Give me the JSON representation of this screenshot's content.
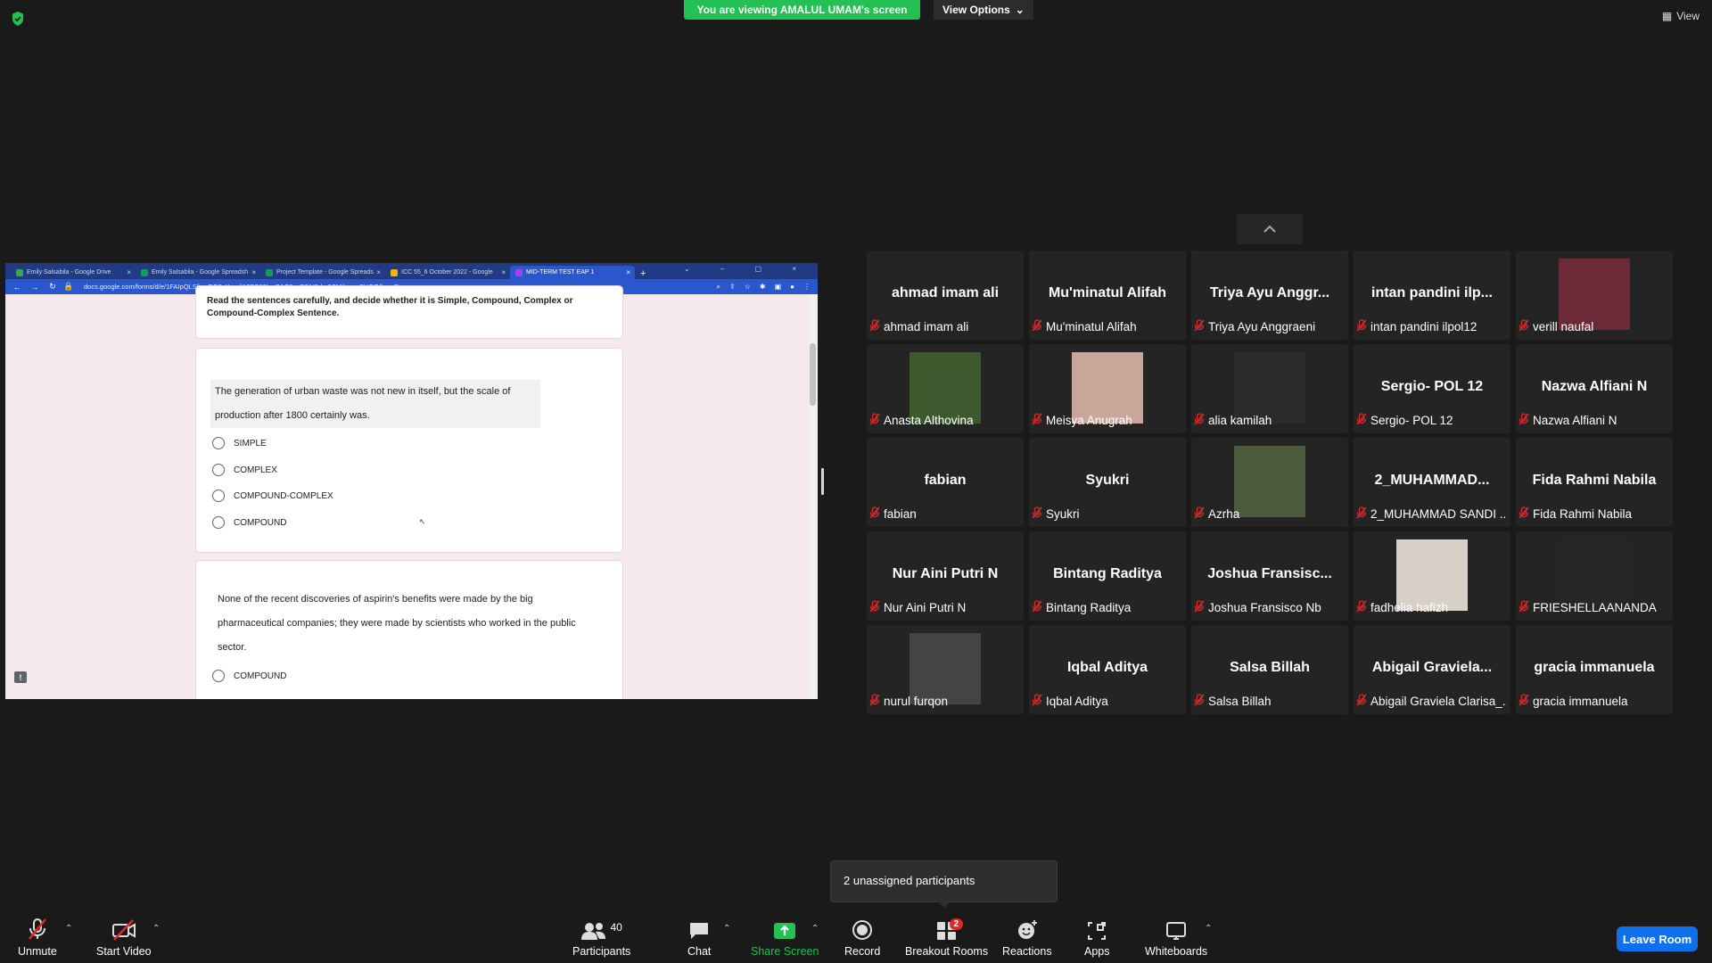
{
  "banner": {
    "viewing": "You are viewing AMALUL UMAM's screen",
    "view_options": "View Options",
    "view": "View"
  },
  "browser": {
    "tabs": [
      {
        "label": "Emily Salsabila - Google Drive",
        "favicon_color": "#34a853"
      },
      {
        "label": "Emily Salsabila - Google Spreadsh",
        "favicon_color": "#0f9d58"
      },
      {
        "label": "Project Template - Google Spreads",
        "favicon_color": "#0f9d58"
      },
      {
        "label": "ICC 55_6 October 2022 - Google",
        "favicon_color": "#f4b400"
      },
      {
        "label": "MID-TERM TEST EAP 1",
        "favicon_color": "#a142f4"
      }
    ],
    "url": "docs.google.com/forms/d/e/1FAIpQLSfjopGG3cXomilA2PS06lupSAC2snD0jH3dm9CMjbvmsSHQQ/formResponse"
  },
  "form": {
    "instructions": "Read the sentences carefully, and decide whether it is Simple, Compound, Complex or Compound-Complex Sentence.",
    "q1": {
      "text": "The generation of urban waste was not new in itself, but the scale of production after 1800 certainly was.",
      "options": [
        "SIMPLE",
        "COMPLEX",
        "COMPOUND-COMPLEX",
        "COMPOUND"
      ]
    },
    "q2": {
      "text": "None of the recent discoveries of aspirin's benefits were made by the big pharmaceutical companies; they were made by scientists who worked in the public sector.",
      "options": [
        "COMPOUND"
      ]
    }
  },
  "participants_tiles": [
    {
      "big": "ahmad imam ali",
      "name": "ahmad imam ali"
    },
    {
      "big": "Mu'minatul Alifah",
      "name": "Mu'minatul Alifah"
    },
    {
      "big": "Triya Ayu Anggr...",
      "name": "Triya Ayu Anggraeni"
    },
    {
      "big": "intan  pandini  ilp...",
      "name": "intan pandini ilpol12"
    },
    {
      "big": "",
      "name": "verill naufal",
      "photo": "#6b2a35"
    },
    {
      "big": "",
      "name": "Anasta Althovina",
      "photo": "#3d5a2e"
    },
    {
      "big": "",
      "name": "Meisya Anugrah",
      "photo": "#c9a69a"
    },
    {
      "big": "",
      "name": "alia kamilah",
      "photo": "#2b2b2b"
    },
    {
      "big": "Sergio- POL 12",
      "name": "Sergio- POL 12"
    },
    {
      "big": "Nazwa Alfiani N",
      "name": "Nazwa Alfiani N"
    },
    {
      "big": "fabian",
      "name": "fabian"
    },
    {
      "big": "Syukri",
      "name": "Syukri"
    },
    {
      "big": "",
      "name": "Azrha",
      "photo": "#4b5a3a"
    },
    {
      "big": "2_MUHAMMAD...",
      "name": "2_MUHAMMAD SANDI ..."
    },
    {
      "big": "Fida Rahmi Nabila",
      "name": "Fida Rahmi Nabila"
    },
    {
      "big": "Nur Aini Putri N",
      "name": "Nur Aini Putri N"
    },
    {
      "big": "Bintang Raditya",
      "name": "Bintang Raditya"
    },
    {
      "big": "Joshua  Fransisc...",
      "name": "Joshua Fransisco Nb"
    },
    {
      "big": "",
      "name": "fadhelia hafizh",
      "photo": "#d8cfc6"
    },
    {
      "big": "",
      "name": "FRIESHELLAANANDA",
      "photo": "#262626"
    },
    {
      "big": "",
      "name": "nurul furqon",
      "photo": "#444444"
    },
    {
      "big": "Iqbal Aditya",
      "name": "Iqbal Aditya"
    },
    {
      "big": "Salsa Billah",
      "name": "Salsa Billah"
    },
    {
      "big": "Abigail  Graviela...",
      "name": "Abigail Graviela Clarisa_..."
    },
    {
      "big": "gracia immanuela",
      "name": "gracia immanuela"
    }
  ],
  "popup": {
    "text": "2 unassigned participants"
  },
  "toolbar": {
    "unmute": "Unmute",
    "start_video": "Start Video",
    "participants": "Participants",
    "participants_count": "40",
    "chat": "Chat",
    "share_screen": "Share Screen",
    "record": "Record",
    "breakout_rooms": "Breakout Rooms",
    "breakout_badge": "2",
    "reactions": "Reactions",
    "apps": "Apps",
    "whiteboards": "Whiteboards",
    "leave_room": "Leave Room"
  },
  "colors": {
    "share_green": "#23c053",
    "leave_blue": "#0e71eb",
    "mic_red": "#e02828"
  }
}
